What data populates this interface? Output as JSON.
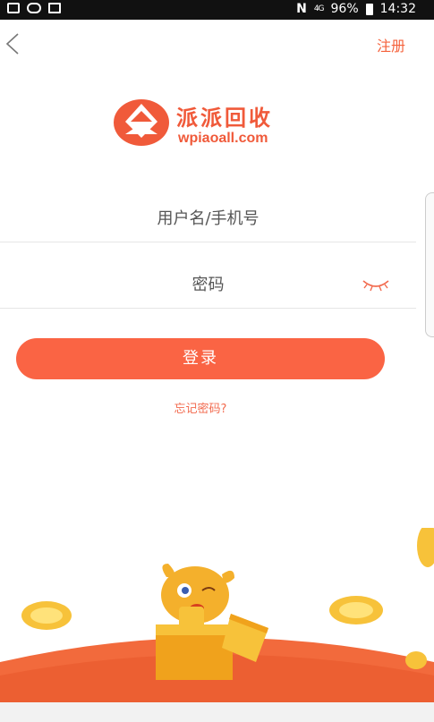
{
  "status_bar": {
    "battery": "96%",
    "time": "14:32",
    "signal_label": "4G",
    "nfc_label": "N"
  },
  "header": {
    "register_label": "注册"
  },
  "brand": {
    "name_cn": "派派回收",
    "name_en": "wpiaoall.com"
  },
  "form": {
    "username_placeholder": "用户名/手机号",
    "password_placeholder": "密码",
    "login_label": "登录",
    "forgot_label": "忘记密码?"
  },
  "colors": {
    "accent": "#fa6444",
    "brand": "#f05a3a"
  },
  "icons": {
    "back": "chevron-left-icon",
    "eye": "eye-closed-icon"
  }
}
